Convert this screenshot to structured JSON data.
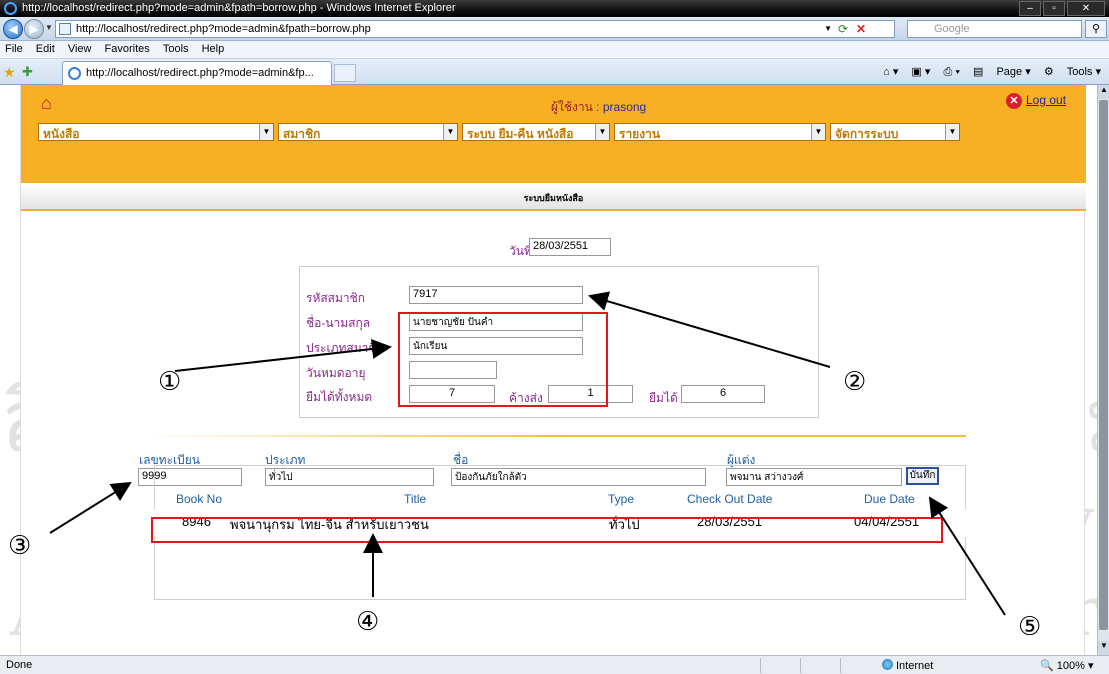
{
  "window": {
    "title": "http://localhost/redirect.php?mode=admin&fpath=borrow.php - Windows Internet Explorer"
  },
  "address": {
    "url": "http://localhost/redirect.php?mode=admin&fpath=borrow.php",
    "search_placeholder": "Google"
  },
  "menu": {
    "items": [
      "File",
      "Edit",
      "View",
      "Favorites",
      "Tools",
      "Help"
    ]
  },
  "tab": {
    "label": "http://localhost/redirect.php?mode=admin&fp..."
  },
  "toolbar": {
    "page": "Page",
    "tools": "Tools"
  },
  "header": {
    "user_label": "ผู้ใช้งาน :",
    "user_name": "prasong",
    "logout": "Log out",
    "menus": [
      "หนังสือ",
      "สมาชิก",
      "ระบบ ยืม-คืน หนังสือ",
      "รายงาน",
      "จัดการระบบ"
    ]
  },
  "panel": {
    "title": "ระบบยืมหนังสือ"
  },
  "form": {
    "date_label": "วันที่",
    "date_value": "28/03/2551",
    "member_id_label": "รหัสสมาชิก",
    "member_id": "7917",
    "name_label": "ชื่อ-นามสกุล",
    "name_value": "นายชาญชัย ปันคำ",
    "type_label": "ประเภทสมาชิก",
    "type_value": "นักเรียน",
    "expire_label": "วันหมดอายุ",
    "expire_value": "",
    "total_label": "ยืมได้ทั้งหมด",
    "total_value": "7",
    "pending_label": "ค้างส่ง",
    "pending_value": "1",
    "available_label": "ยืมได้",
    "available_value": "6"
  },
  "book_form": {
    "reg_label": "เลขทะเบียน",
    "reg_value": "9999",
    "category_label": "ประเภท",
    "category_value": "ทั่วไป",
    "name_label": "ชื่อ",
    "name_value": "ป้องกันภัยใกล้ตัว",
    "author_label": "ผู้แต่ง",
    "author_value": "พจมาน สว่างวงศ์",
    "save_button": "บันทึก"
  },
  "table": {
    "columns": [
      "Book No",
      "Title",
      "Type",
      "Check Out Date",
      "Due Date"
    ],
    "rows": [
      [
        "8946",
        "พจนานุกรม ไทย-จีน สำหรับเยาวชน",
        "ทั่วไป",
        "28/03/2551",
        "04/04/2551"
      ]
    ]
  },
  "annotations": [
    "①",
    "②",
    "③",
    "④",
    "⑤"
  ],
  "watermark": {
    "line1": "ลิขสิทธิ์มหาวิทยาลัยเชียงใหม่",
    "line2": "Copyright © by Chiang Mai University",
    "line3": "All rights reserved",
    "arc": "CHIANG MAI UNIVERSITY"
  },
  "status": {
    "text": "Done",
    "zone": "Internet",
    "zoom": "100%"
  },
  "colors": {
    "header_bg": "#f7b024",
    "highlight": "#e8141a",
    "label_purple": "#8b2a8b",
    "label_blue": "#1f5fa6"
  }
}
